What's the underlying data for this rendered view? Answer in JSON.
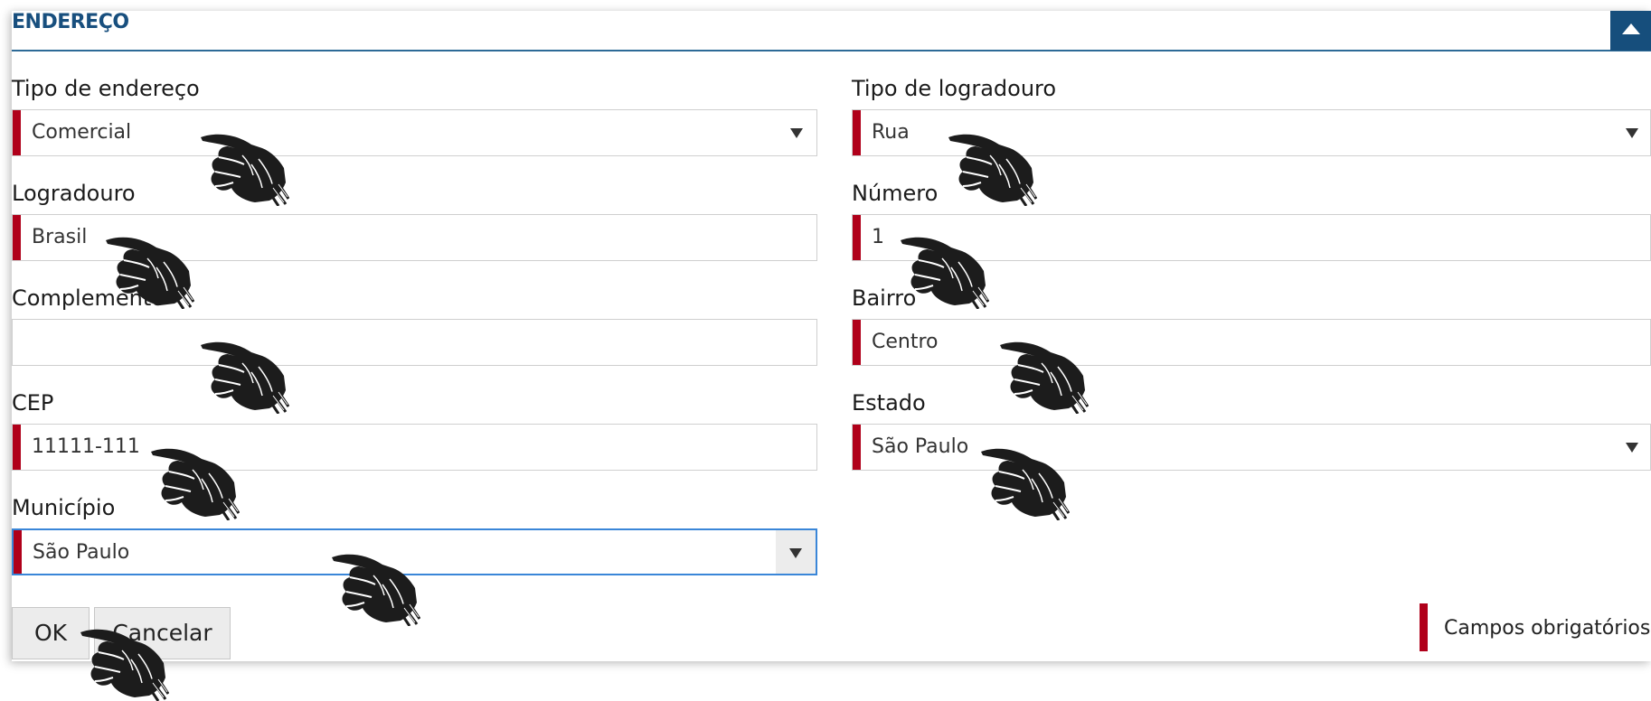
{
  "section": {
    "title": "ENDEREÇO",
    "collapse_icon": "chevron-up-icon"
  },
  "fields": {
    "tipo_endereco": {
      "label": "Tipo de endereço",
      "value": "Comercial",
      "required": true,
      "type": "select"
    },
    "tipo_logradouro": {
      "label": "Tipo de logradouro",
      "value": "Rua",
      "required": true,
      "type": "select"
    },
    "logradouro": {
      "label": "Logradouro",
      "value": "Brasil",
      "required": true,
      "type": "text"
    },
    "numero": {
      "label": "Número",
      "value": "1",
      "required": true,
      "type": "text"
    },
    "complemento": {
      "label": "Complemento",
      "value": "",
      "required": false,
      "type": "text"
    },
    "bairro": {
      "label": "Bairro",
      "value": "Centro",
      "required": true,
      "type": "text"
    },
    "cep": {
      "label": "CEP",
      "value": "11111-111",
      "required": true,
      "type": "text"
    },
    "estado": {
      "label": "Estado",
      "value": "São Paulo",
      "required": true,
      "type": "select"
    },
    "municipio": {
      "label": "Município",
      "value": "São Paulo",
      "required": true,
      "type": "select",
      "focused": true
    }
  },
  "buttons": {
    "ok": "OK",
    "cancel": "Cancelar"
  },
  "legend": {
    "required_label": "Campos obrigatórios",
    "required_color": "#b0001a"
  },
  "colors": {
    "header_accent": "#164e7c",
    "focus_border": "#3a86d8"
  },
  "overlay_icon": "pointing-hand-icon"
}
